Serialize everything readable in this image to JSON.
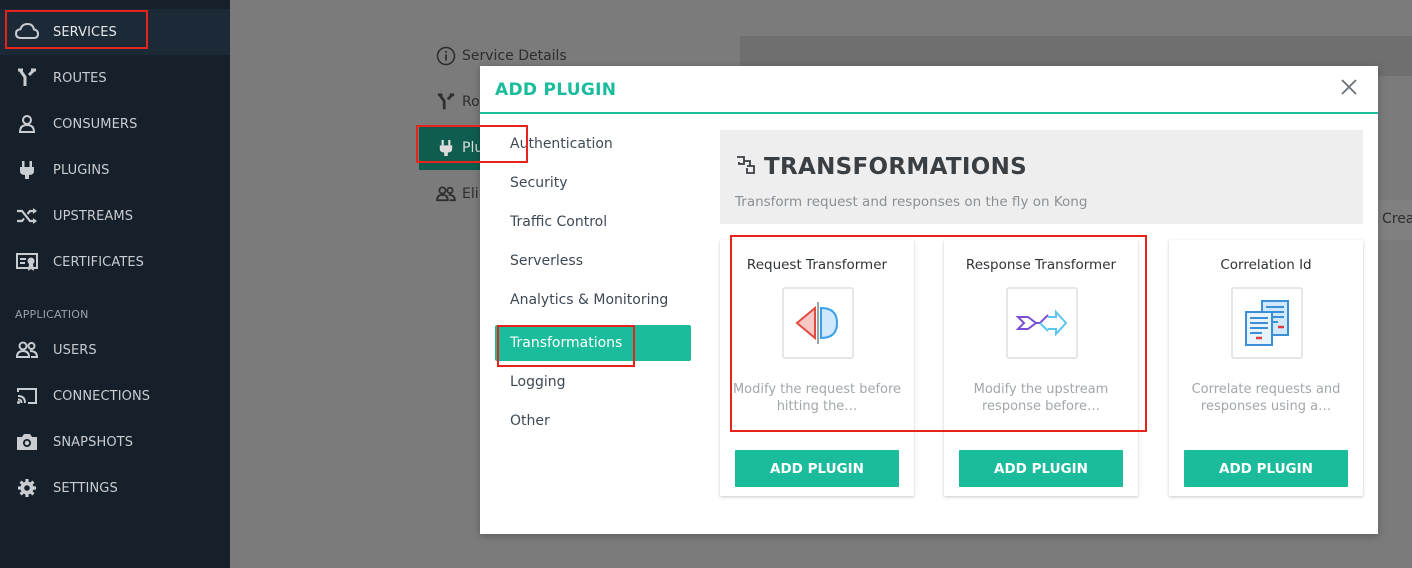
{
  "sidebar": {
    "items": [
      {
        "label": "SERVICES",
        "icon": "cloud-icon"
      },
      {
        "label": "ROUTES",
        "icon": "routes-icon"
      },
      {
        "label": "CONSUMERS",
        "icon": "user-icon"
      },
      {
        "label": "PLUGINS",
        "icon": "plug-icon"
      },
      {
        "label": "UPSTREAMS",
        "icon": "shuffle-icon"
      },
      {
        "label": "CERTIFICATES",
        "icon": "certificate-icon"
      }
    ],
    "section_label": "APPLICATION",
    "app_items": [
      {
        "label": "USERS",
        "icon": "users-icon"
      },
      {
        "label": "CONNECTIONS",
        "icon": "cast-icon"
      },
      {
        "label": "SNAPSHOTS",
        "icon": "camera-icon"
      },
      {
        "label": "SETTINGS",
        "icon": "gear-icon"
      }
    ]
  },
  "background": {
    "links": [
      {
        "label": "Service Details",
        "icon": "info-icon"
      },
      {
        "label": "Ro",
        "icon": "routes-icon"
      },
      {
        "label": "Plu",
        "icon": "plug-icon"
      },
      {
        "label": "Eli",
        "icon": "users-icon"
      }
    ],
    "right_text": "Crea"
  },
  "modal": {
    "title": "ADD PLUGIN",
    "categories": [
      "Authentication",
      "Security",
      "Traffic Control",
      "Serverless",
      "Analytics & Monitoring",
      "Transformations",
      "Logging",
      "Other"
    ],
    "selected_category": "Transformations",
    "header": {
      "title": "TRANSFORMATIONS",
      "description": "Transform request and responses on the fly on Kong"
    },
    "cards": [
      {
        "name": "Request Transformer",
        "description": "Modify the request before hitting the…",
        "button": "ADD PLUGIN",
        "icon": "request-transformer-icon"
      },
      {
        "name": "Response Transformer",
        "description": "Modify the upstream response before…",
        "button": "ADD PLUGIN",
        "icon": "response-transformer-icon"
      },
      {
        "name": "Correlation Id",
        "description": "Correlate requests and responses using a…",
        "button": "ADD PLUGIN",
        "icon": "correlation-id-icon"
      }
    ]
  },
  "colors": {
    "accent": "#1abc9c",
    "sidebar_bg": "#16202a",
    "highlight": "#e8231b"
  }
}
